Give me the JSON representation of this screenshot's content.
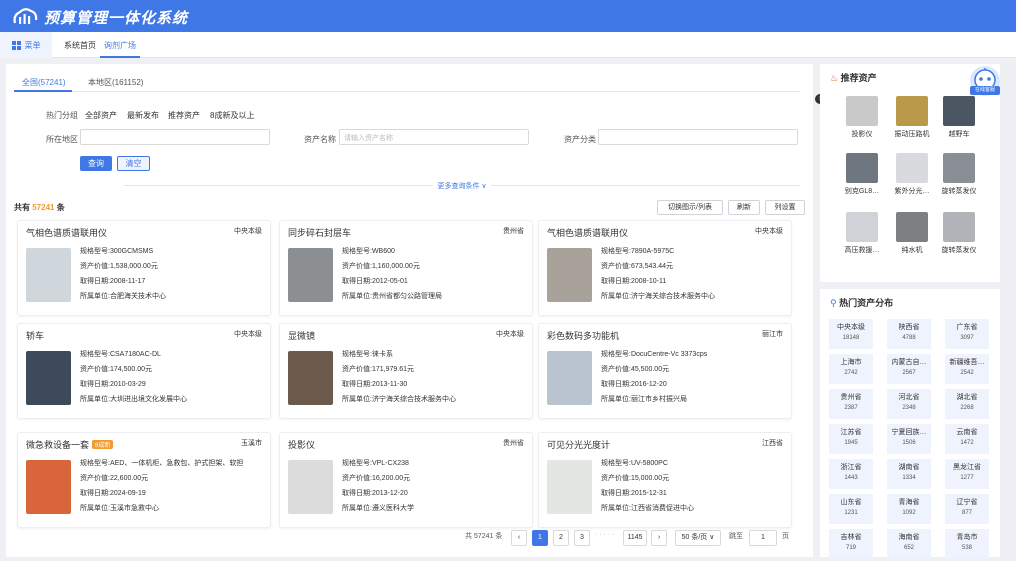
{
  "header": {
    "title": "预算管理一体化系统"
  },
  "nav": {
    "menu_label": "菜单",
    "tabs": [
      "系统首页",
      "询剂广场"
    ]
  },
  "tabs": [
    {
      "label": "全国(57241)"
    },
    {
      "label": "本地区(161152)"
    }
  ],
  "filters": {
    "hot_label": "热门分组",
    "hot_options": [
      "全部资产",
      "最新发布",
      "推荐资产",
      "8成新及以上"
    ],
    "region_label": "所在地区",
    "asset_name_label": "资产名称",
    "asset_name_placeholder": "请输入资产名称",
    "category_label": "资产分类",
    "query_btn": "查询",
    "clear_btn": "清空",
    "more": "更多查询条件 ∨"
  },
  "toolbar": {
    "total_prefix": "共有",
    "total": "57241",
    "total_suffix": "条",
    "switch_btn": "切换图示/列表",
    "refresh_btn": "刷新",
    "columns_btn": "列设置"
  },
  "cards": [
    {
      "title": "气相色谱质谱联用仪",
      "region": "中央本级",
      "badge": "",
      "lines": [
        "规格型号:300GCMSMS",
        "资产价值:1,538,000.00元",
        "取得日期:2008-11-17",
        "所属单位:合肥海关技术中心"
      ],
      "color": "#cfd6dc"
    },
    {
      "title": "同步碎石封层车",
      "region": "贵州省",
      "badge": "",
      "lines": [
        "规格型号:WB600",
        "资产价值:1,160,000.00元",
        "取得日期:2012-05-01",
        "所属单位:贵州省都匀公路管理局"
      ],
      "color": "#8c8f92"
    },
    {
      "title": "气相色谱质谱联用仪",
      "region": "中央本级",
      "badge": "",
      "lines": [
        "规格型号:7890A-5975C",
        "资产价值:673,543.44元",
        "取得日期:2008-10-11",
        "所属单位:济宁海关综合技术服务中心"
      ],
      "color": "#a9a29a"
    },
    {
      "title": "轿车",
      "region": "中央本级",
      "badge": "",
      "lines": [
        "规格型号:CSA7180AC-DL",
        "资产价值:174,500.00元",
        "取得日期:2010-03-29",
        "所属单位:大圳进出境文化发展中心"
      ],
      "color": "#3d4a5c"
    },
    {
      "title": "显微镜",
      "region": "中央本级",
      "badge": "",
      "lines": [
        "规格型号:徕卡系",
        "资产价值:171,979.61元",
        "取得日期:2013-11-30",
        "所属单位:济宁海关综合技术服务中心"
      ],
      "color": "#6b5a4c"
    },
    {
      "title": "彩色数码多功能机",
      "region": "丽江市",
      "badge": "",
      "lines": [
        "规格型号:DocuCentre-Vc 3373cps",
        "资产价值:45,500.00元",
        "取得日期:2016-12-20",
        "所属单位:丽江市乡村振兴局"
      ],
      "color": "#b9c4cf"
    },
    {
      "title": "微急救设备一套",
      "region": "玉溪市",
      "badge": "8成新",
      "lines": [
        "规格型号:AED、一体机柜、急救包、护式担架、软担",
        "资产价值:22,600.00元",
        "取得日期:2024-09-19",
        "所属单位:玉溪市急救中心"
      ],
      "color": "#d9653b"
    },
    {
      "title": "投影仪",
      "region": "贵州省",
      "badge": "",
      "lines": [
        "规格型号:VPL-CX238",
        "资产价值:16,200.00元",
        "取得日期:2013-12-20",
        "所属单位:遵义医科大学"
      ],
      "color": "#dcdcdc"
    },
    {
      "title": "可见分光光度计",
      "region": "江西省",
      "badge": "",
      "lines": [
        "规格型号:UV-5800PC",
        "资产价值:15,000.00元",
        "取得日期:2015-12-31",
        "所属单位:江西省消费促进中心"
      ],
      "color": "#e4e6e2"
    }
  ],
  "pagination": {
    "total_text": "共 57241 条",
    "prev": "‹",
    "pages": [
      "1",
      "2",
      "3"
    ],
    "ellipsis": "· · · · ·",
    "last": "1145",
    "next": "›",
    "per_page": "50 条/页 ∨",
    "goto_label": "跳至",
    "goto_value": "1",
    "page_label": "页"
  },
  "recommend": {
    "title": "推荐资产",
    "items": [
      {
        "label": "投影仪",
        "color": "#c9c9c9"
      },
      {
        "label": "振动压路机",
        "color": "#b89a4a"
      },
      {
        "label": "越野车",
        "color": "#4c5663"
      },
      {
        "label": "别克GL8…",
        "color": "#6e7680"
      },
      {
        "label": "紫外分光…",
        "color": "#d8dadd"
      },
      {
        "label": "旋转蒸发仪",
        "color": "#8a8f96"
      },
      {
        "label": "高压救援…",
        "color": "#cfd3d8"
      },
      {
        "label": "纯水机",
        "color": "#7d7f82"
      },
      {
        "label": "旋转蒸发仪",
        "color": "#b0b4b8"
      }
    ]
  },
  "robot": {
    "tag": "在线客服"
  },
  "distribution": {
    "title": "热门资产分布",
    "items": [
      {
        "name": "中央本级",
        "count": "18148"
      },
      {
        "name": "陕西省",
        "count": "4788"
      },
      {
        "name": "广东省",
        "count": "3097"
      },
      {
        "name": "上海市",
        "count": "2742"
      },
      {
        "name": "内蒙古自…",
        "count": "2567"
      },
      {
        "name": "新疆维吾…",
        "count": "2542"
      },
      {
        "name": "贵州省",
        "count": "2387"
      },
      {
        "name": "河北省",
        "count": "2348"
      },
      {
        "name": "湖北省",
        "count": "2268"
      },
      {
        "name": "江苏省",
        "count": "1945"
      },
      {
        "name": "宁夏回族…",
        "count": "1506"
      },
      {
        "name": "云南省",
        "count": "1472"
      },
      {
        "name": "浙江省",
        "count": "1443"
      },
      {
        "name": "湖南省",
        "count": "1334"
      },
      {
        "name": "黑龙江省",
        "count": "1277"
      },
      {
        "name": "山东省",
        "count": "1231"
      },
      {
        "name": "青海省",
        "count": "1092"
      },
      {
        "name": "辽宁省",
        "count": "877"
      },
      {
        "name": "吉林省",
        "count": "719"
      },
      {
        "name": "海南省",
        "count": "652"
      },
      {
        "name": "青岛市",
        "count": "538"
      }
    ]
  },
  "colors": {
    "primary": "#3f78e6",
    "accent": "#f29a2e"
  }
}
